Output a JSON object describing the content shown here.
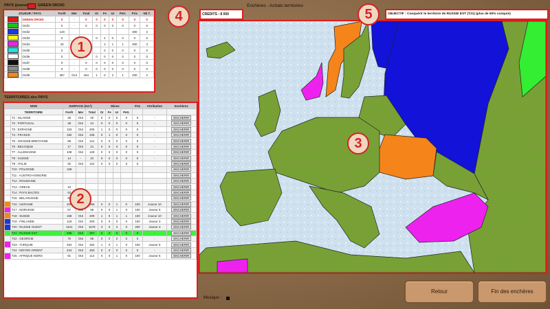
{
  "header": {
    "title": "Enchères - Achats territoires",
    "credits": "CREDITS : 8 000",
    "objective": "OBJECTIF : Conquérir le territoire de RUSSIE EST (T21) (plus de 60% conquis)"
  },
  "players_panel": {
    "label": "PAYS (joueurs)",
    "current_player": "GREEN DROID",
    "current_color": "#e01b1b",
    "columns": [
      "JOUEUR / PAYS",
      "Forêt",
      "Mer",
      "Total",
      "Or",
      "Fe",
      "Ur",
      "Petr.",
      "Prix",
      "Nb T."
    ],
    "rows": [
      {
        "color": "#e01b1b",
        "name": "GREEN DROID",
        "cells": [
          "0",
          "-",
          "0",
          "0",
          "0",
          "0",
          "0",
          "0",
          "0"
        ],
        "highlight": true
      },
      {
        "color": "#19c419",
        "name": "Ordi1",
        "cells": [
          "0",
          "-",
          "0",
          "0",
          "0",
          "0",
          "0",
          "0",
          "0"
        ]
      },
      {
        "color": "#1a3ad6",
        "name": "Ordi2",
        "cells": [
          "129",
          "",
          "",
          "",
          "",
          "",
          "",
          "300",
          "2"
        ]
      },
      {
        "color": "#f5f510",
        "name": "Ordi3",
        "cells": [
          "0",
          "",
          "",
          "0",
          "4",
          "0",
          "0",
          "0",
          "0"
        ]
      },
      {
        "color": "#ee22ee",
        "name": "Ordi4",
        "cells": [
          "40",
          "",
          "",
          "",
          "2",
          "1",
          "1",
          "300",
          "3"
        ]
      },
      {
        "color": "#22e0e0",
        "name": "Ordi5",
        "cells": [
          "0",
          "",
          "",
          "",
          "0",
          "0",
          "0",
          "0",
          "0"
        ]
      },
      {
        "color": "#ffffff",
        "name": "Ordi6",
        "cells": [
          "0",
          "-",
          "0",
          "0",
          "0",
          "0",
          "0",
          "0",
          "0"
        ]
      },
      {
        "color": "#111111",
        "name": "Ordi7",
        "cells": [
          "0",
          "-",
          "0",
          "0",
          "0",
          "0",
          "0",
          "0",
          "0"
        ]
      },
      {
        "color": "#8a8a8a",
        "name": "Ordi8",
        "cells": [
          "0",
          "-",
          "0",
          "0",
          "0",
          "0",
          "0",
          "0",
          "0"
        ]
      },
      {
        "color": "#f08a1a",
        "name": "Ordi9",
        "cells": [
          "367",
          "OUI",
          "464",
          "1",
          "0",
          "2",
          "1",
          "200",
          "2"
        ]
      }
    ]
  },
  "territories_panel": {
    "label": "TERRITOIRES des PAYS",
    "group_headers": [
      "NOM",
      "SURFACE (Km²)",
      "Mines",
      "Prix",
      "Attribution",
      "Enchères"
    ],
    "columns": [
      "TERRITOIRE",
      "Forêt",
      "Mer",
      "Total",
      "Or",
      "Fe",
      "Ur",
      "Petr."
    ],
    "bid_label": "ENCHERIR",
    "rows": [
      {
        "color": "",
        "name": "T1 : ISLANDE",
        "cells": [
          "36",
          "OUI",
          "40",
          "0",
          "0",
          "0",
          "0",
          "0"
        ],
        "attr": "-"
      },
      {
        "color": "",
        "name": "T2 : PORTUGAL",
        "cells": [
          "38",
          "OUI",
          "44",
          "0",
          "0",
          "0",
          "0",
          "0"
        ],
        "attr": "-"
      },
      {
        "color": "",
        "name": "T3 : ESPAGNE",
        "cells": [
          "153",
          "OUI",
          "206",
          "1",
          "0",
          "0",
          "0",
          "0"
        ],
        "attr": "-"
      },
      {
        "color": "",
        "name": "T4 : FRANCE",
        "cells": [
          "182",
          "OUI",
          "236",
          "0",
          "1",
          "0",
          "0",
          "0"
        ],
        "attr": "-"
      },
      {
        "color": "",
        "name": "T5 : GRANDE-BRETAGNE",
        "cells": [
          "88",
          "OUI",
          "121",
          "0",
          "0",
          "0",
          "0",
          "0"
        ],
        "attr": "-"
      },
      {
        "color": "",
        "name": "T6 : BELGIQUE",
        "cells": [
          "17",
          "OUI",
          "21",
          "0",
          "0",
          "0",
          "0",
          "0"
        ],
        "attr": "-"
      },
      {
        "color": "",
        "name": "T7 : ALLEMAGNE",
        "cells": [
          "108",
          "OUI",
          "128",
          "0",
          "0",
          "0",
          "0",
          "0"
        ],
        "attr": "-"
      },
      {
        "color": "",
        "name": "T8 : SUISSE",
        "cells": [
          "14",
          "-",
          "22",
          "0",
          "0",
          "0",
          "0",
          "0"
        ],
        "attr": "-"
      },
      {
        "color": "",
        "name": "T9 : ITALIE",
        "cells": [
          "92",
          "OUI",
          "122",
          "0",
          "0",
          "0",
          "0",
          "0"
        ],
        "attr": "-"
      },
      {
        "color": "",
        "name": "T10 : POLOGNE",
        "cells": [
          "108",
          "",
          "",
          "",
          "",
          "",
          "",
          ""
        ],
        "attr": ""
      },
      {
        "color": "",
        "name": "T11 : AUSTRO-HONGRIE",
        "cells": [
          "",
          "",
          "",
          "",
          "",
          "",
          "",
          ""
        ],
        "attr": ""
      },
      {
        "color": "",
        "name": "T12 : ROUMANIE",
        "cells": [
          "",
          "",
          "",
          "",
          "",
          "",
          "",
          ""
        ],
        "attr": ""
      },
      {
        "color": "",
        "name": "T13 : GRECE",
        "cells": [
          "34",
          "",
          "",
          "",
          "",
          "",
          "",
          ""
        ],
        "attr": ""
      },
      {
        "color": "",
        "name": "T14 : PAYS BALTES",
        "cells": [
          "53",
          "",
          "",
          "",
          "",
          "",
          "",
          ""
        ],
        "attr": ""
      },
      {
        "color": "",
        "name": "T15 : BELARUSSIE",
        "cells": [
          "87",
          "",
          "",
          "",
          "",
          "",
          "",
          ""
        ],
        "attr": ""
      },
      {
        "color": "#f08a1a",
        "name": "T16 : UKRAINE",
        "cells": [
          "209",
          "OUI",
          "256",
          "0",
          "0",
          "1",
          "0",
          "100"
        ],
        "attr": "Joueur 10"
      },
      {
        "color": "#ee22ee",
        "name": "T17 : NORVEGE",
        "cells": [
          "67",
          "OUI",
          "98",
          "0",
          "0",
          "1",
          "0",
          "100"
        ],
        "attr": "Joueur 5"
      },
      {
        "color": "#f08a1a",
        "name": "T18 : SUEDE",
        "cells": [
          "158",
          "OUI",
          "209",
          "1",
          "0",
          "1",
          "1",
          "100"
        ],
        "attr": "Joueur 10"
      },
      {
        "color": "#1a3ad6",
        "name": "T19 : FINLANDE",
        "cells": [
          "118",
          "OUI",
          "200",
          "0",
          "0",
          "0",
          "0",
          "100"
        ],
        "attr": "Joueur 3"
      },
      {
        "color": "#1a3ad6",
        "name": "T20 : RUSSIE OUEST",
        "cells": [
          "1101",
          "OUI",
          "1578",
          "3",
          "0",
          "2",
          "0",
          "200"
        ],
        "attr": "Joueur 3"
      },
      {
        "color": "",
        "name": "T21 : RUSSIE EST",
        "cells": [
          "299",
          "OUI",
          "387",
          "0",
          "0",
          "0",
          "0",
          "0"
        ],
        "attr": "-",
        "selected": true
      },
      {
        "color": "",
        "name": "T22 : GEORGIE",
        "cells": [
          "70",
          "OUI",
          "95",
          "0",
          "0",
          "0",
          "0",
          "0"
        ],
        "attr": "-"
      },
      {
        "color": "#ee22ee",
        "name": "T23 : TURQUIE",
        "cells": [
          "254",
          "OUI",
          "332",
          "1",
          "0",
          "1",
          "0",
          "100"
        ],
        "attr": "Joueur 5"
      },
      {
        "color": "",
        "name": "T24 : MOYEN ORIENT",
        "cells": [
          "344",
          "OUI",
          "450",
          "0",
          "0",
          "0",
          "0",
          "0"
        ],
        "attr": "-"
      },
      {
        "color": "#ee22ee",
        "name": "T25 : AFRIQUE NORD",
        "cells": [
          "81",
          "OUI",
          "114",
          "0",
          "0",
          "1",
          "0",
          "100"
        ],
        "attr": "Joueur 5"
      }
    ]
  },
  "footer": {
    "music_label": "Musique :",
    "back_label": "Retour",
    "end_label": "Fin des enchères"
  },
  "callouts": [
    "1",
    "2",
    "3",
    "4",
    "5"
  ],
  "colors": {
    "map_green": "#76a234",
    "map_orange": "#f5841a",
    "map_blue": "#1212d8",
    "map_magenta": "#ee22ee",
    "map_lightgreen": "#33ee33",
    "sea": "#cfe1ee",
    "frame_red": "#e01b1b",
    "background": "#8a6a48"
  }
}
